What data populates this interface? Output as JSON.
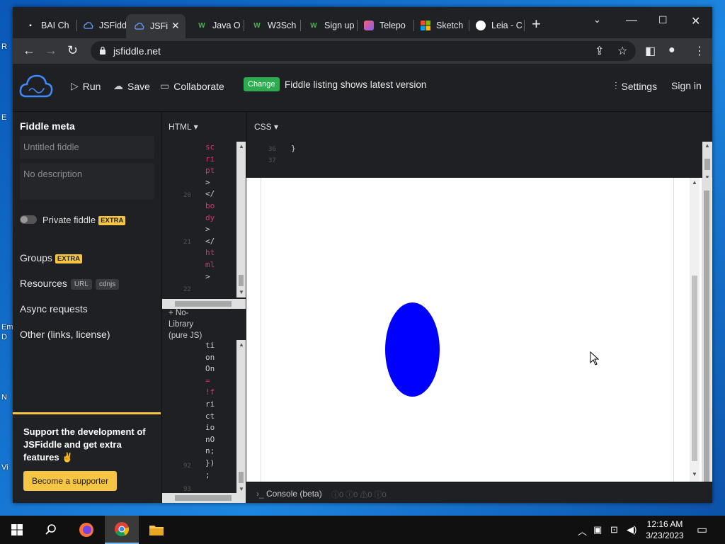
{
  "desktop": {
    "labels": [
      "R",
      "E",
      "Em",
      "D",
      "N",
      "Vi"
    ]
  },
  "browser": {
    "tabs": [
      {
        "label": "BAI Ch",
        "icon": "bai-icon"
      },
      {
        "label": "JSFiddl",
        "icon": "jsfiddle-icon"
      },
      {
        "label": "JSFi",
        "icon": "jsfiddle-icon",
        "active": true
      },
      {
        "label": "Java O",
        "icon": "w3schools-icon"
      },
      {
        "label": "W3Sch",
        "icon": "w3schools-icon"
      },
      {
        "label": "Sign up",
        "icon": "w3schools-icon"
      },
      {
        "label": "Telepo",
        "icon": "teleport-icon"
      },
      {
        "label": "Sketch",
        "icon": "microsoft-icon"
      },
      {
        "label": "Leia - C",
        "icon": "leia-icon"
      }
    ],
    "url": "jsfiddle.net"
  },
  "header": {
    "run": "Run",
    "save": "Save",
    "collaborate": "Collaborate",
    "change": "Change",
    "listing": "Fiddle listing shows latest version",
    "settings": "Settings",
    "signin": "Sign in"
  },
  "sidebar": {
    "title": "Fiddle meta",
    "title_placeholder": "Untitled fiddle",
    "desc_placeholder": "No description",
    "private": "Private fiddle",
    "extra": "EXTRA",
    "groups": "Groups",
    "resources": "Resources",
    "url_pill": "URL",
    "cdnjs_pill": "cdnjs",
    "async": "Async requests",
    "other": "Other (links, license)",
    "support_text": "Support the development of JSFiddle and get extra features ✌",
    "support_btn": "Become a supporter"
  },
  "html_panel": {
    "tab": "HTML",
    "lines": [
      "sc",
      "ri",
      "pt",
      ">",
      "</",
      "bo",
      "dy",
      ">",
      "</",
      "ht",
      "ml",
      ">"
    ],
    "line_numbers": [
      "20",
      "21",
      "22"
    ]
  },
  "js_panel": {
    "header": [
      "+ No-",
      "Library",
      "(pure JS)"
    ],
    "lines": [
      "ti",
      "on",
      "On",
      "=",
      "!f",
      "ri",
      "ct",
      "io",
      "nO",
      "n;",
      "})",
      ";"
    ],
    "line_numbers": [
      "92",
      "93"
    ]
  },
  "css_panel": {
    "tab": "CSS",
    "lines": [
      "}",
      ""
    ],
    "line_numbers": [
      "36",
      "37"
    ]
  },
  "console": {
    "label": "Console (beta)",
    "counts": "ⓘ0  ⓘ0  ⚠0  ⓘ0"
  },
  "taskbar": {
    "time": "12:16 AM",
    "date": "3/23/2023"
  }
}
